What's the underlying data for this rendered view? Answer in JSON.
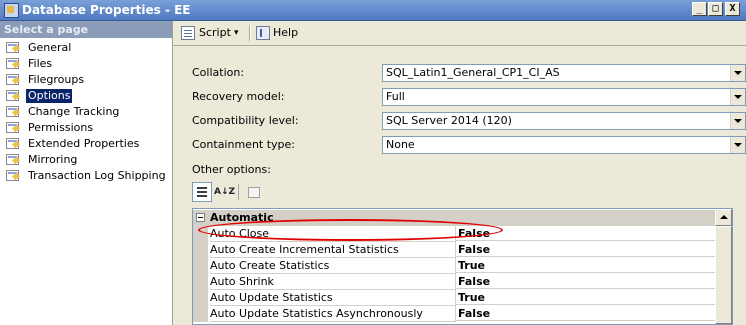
{
  "window": {
    "title": "Database Properties - EE",
    "controls": [
      "_",
      "□",
      "X"
    ]
  },
  "sidebar": {
    "header": "Select a page",
    "items": [
      {
        "label": "General"
      },
      {
        "label": "Files"
      },
      {
        "label": "Filegroups"
      },
      {
        "label": "Options",
        "selected": true
      },
      {
        "label": "Change Tracking"
      },
      {
        "label": "Permissions"
      },
      {
        "label": "Extended Properties"
      },
      {
        "label": "Mirroring"
      },
      {
        "label": "Transaction Log Shipping"
      }
    ]
  },
  "toolbar": {
    "script_label": "Script",
    "script_dropdown_glyph": "▾",
    "help_label": "Help"
  },
  "form": {
    "collation": {
      "label": "Collation:",
      "value": "SQL_Latin1_General_CP1_CI_AS"
    },
    "recovery": {
      "label": "Recovery model:",
      "value": "Full"
    },
    "compatibility": {
      "label": "Compatibility level:",
      "value": "SQL Server 2014 (120)"
    },
    "containment": {
      "label": "Containment type:",
      "value": "None"
    },
    "other_options_label": "Other options:"
  },
  "grid_toolbar": {
    "sort_az_glyph": "A↓Z"
  },
  "property_grid": {
    "category": "Automatic",
    "rows": [
      {
        "name": "Auto Close",
        "value": "False"
      },
      {
        "name": "Auto Create Incremental Statistics",
        "value": "False"
      },
      {
        "name": "Auto Create Statistics",
        "value": "True"
      },
      {
        "name": "Auto Shrink",
        "value": "False"
      },
      {
        "name": "Auto Update Statistics",
        "value": "True"
      },
      {
        "name": "Auto Update Statistics Asynchronously",
        "value": "False"
      }
    ]
  },
  "colors": {
    "title_bar": "#4f79c2",
    "selection": "#0a246a",
    "annotation": "#e00000"
  }
}
